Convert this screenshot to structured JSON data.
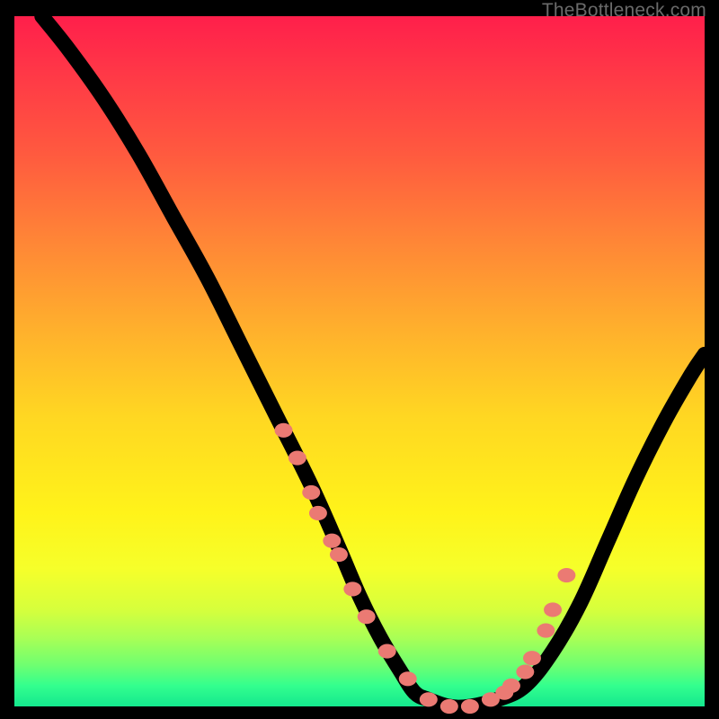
{
  "watermark": {
    "text": "TheBottleneck.com"
  },
  "chart_data": {
    "type": "line",
    "title": "",
    "xlabel": "",
    "ylabel": "",
    "xlim": [
      0,
      100
    ],
    "ylim": [
      0,
      100
    ],
    "series": [
      {
        "name": "bottleneck-curve",
        "x": [
          4,
          8,
          13,
          18,
          23,
          28,
          33,
          38,
          43,
          47,
          50,
          53,
          56,
          58,
          60,
          63,
          66,
          70,
          74,
          78,
          82,
          86,
          90,
          94,
          98,
          100
        ],
        "y": [
          100,
          95,
          88,
          80,
          71,
          62,
          52,
          42,
          32,
          23,
          16,
          10,
          5,
          2,
          1,
          0,
          0,
          1,
          3,
          8,
          15,
          24,
          33,
          41,
          48,
          51
        ]
      }
    ],
    "markers": {
      "name": "highlighted-points",
      "color": "#eb7a73",
      "x": [
        39,
        41,
        43,
        44,
        46,
        47,
        49,
        51,
        54,
        57,
        60,
        63,
        66,
        69,
        71,
        72,
        74,
        75,
        77,
        78,
        80
      ],
      "y": [
        40,
        36,
        31,
        28,
        24,
        22,
        17,
        13,
        8,
        4,
        1,
        0,
        0,
        1,
        2,
        3,
        5,
        7,
        11,
        14,
        19
      ]
    },
    "background_gradient": {
      "top": "#ff1f4b",
      "middle": "#ffe21e",
      "bottom": "#14e88e"
    }
  }
}
